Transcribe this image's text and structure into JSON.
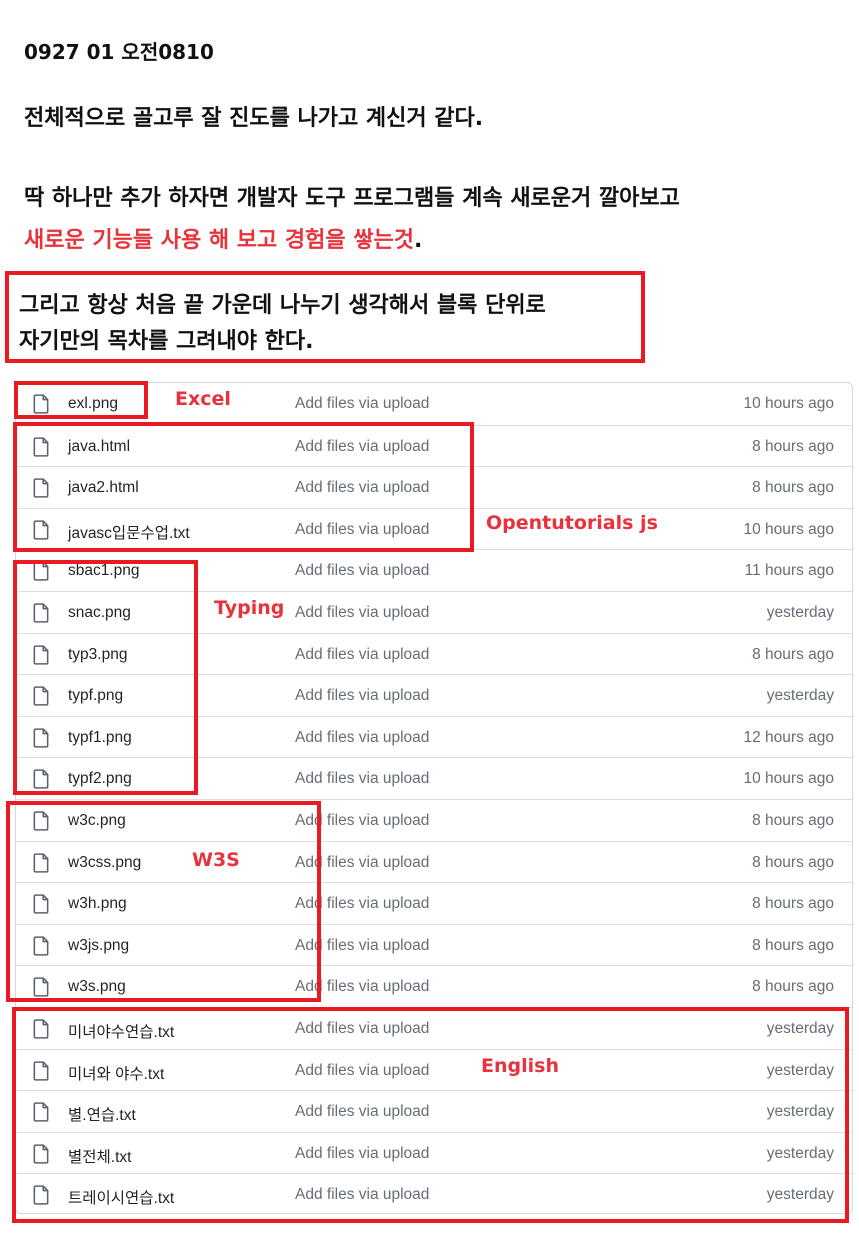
{
  "note": {
    "date": "0927 01 오전0810",
    "line1": "전체적으로 골고루 잘 진도를 나가고 계신거 같다.",
    "line2": "딱 하나만 추가 하자면 개발자 도구 프로그램들 계속 새로운거 깔아보고",
    "line3_red": "새로운 기능들 사용 해 보고 경험을 쌓는것",
    "line3_end": ".",
    "box_line1": "그리고 항상 처음 끝 가운데 나누기 생각해서 블록 단위로",
    "box_line2": "자기만의 목차를 그려내야 한다."
  },
  "files": [
    {
      "name": "exl.png",
      "message": "Add files via upload",
      "time": "10 hours ago",
      "icon": "file-icon"
    },
    {
      "name": "java.html",
      "message": "Add files via upload",
      "time": "8 hours ago",
      "icon": "file-icon"
    },
    {
      "name": "java2.html",
      "message": "Add files via upload",
      "time": "8 hours ago",
      "icon": "file-icon"
    },
    {
      "name": "javasc입문수업.txt",
      "message": "Add files via upload",
      "time": "10 hours ago",
      "icon": "file-icon"
    },
    {
      "name": "sbac1.png",
      "message": "Add files via upload",
      "time": "11 hours ago",
      "icon": "file-icon"
    },
    {
      "name": "snac.png",
      "message": "Add files via upload",
      "time": "yesterday",
      "icon": "file-icon"
    },
    {
      "name": "typ3.png",
      "message": "Add files via upload",
      "time": "8 hours ago",
      "icon": "file-icon"
    },
    {
      "name": "typf.png",
      "message": "Add files via upload",
      "time": "yesterday",
      "icon": "file-icon"
    },
    {
      "name": "typf1.png",
      "message": "Add files via upload",
      "time": "12 hours ago",
      "icon": "file-icon"
    },
    {
      "name": "typf2.png",
      "message": "Add files via upload",
      "time": "10 hours ago",
      "icon": "file-icon"
    },
    {
      "name": "w3c.png",
      "message": "Add files via upload",
      "time": "8 hours ago",
      "icon": "file-icon"
    },
    {
      "name": "w3css.png",
      "message": "Add files via upload",
      "time": "8 hours ago",
      "icon": "file-icon"
    },
    {
      "name": "w3h.png",
      "message": "Add files via upload",
      "time": "8 hours ago",
      "icon": "file-icon"
    },
    {
      "name": "w3js.png",
      "message": "Add files via upload",
      "time": "8 hours ago",
      "icon": "file-icon"
    },
    {
      "name": "w3s.png",
      "message": "Add files via upload",
      "time": "8 hours ago",
      "icon": "file-icon"
    },
    {
      "name": "미녀야수연습.txt",
      "message": "Add files via upload",
      "time": "yesterday",
      "icon": "file-icon"
    },
    {
      "name": "미녀와 야수.txt",
      "message": "Add files via upload",
      "time": "yesterday",
      "icon": "file-icon"
    },
    {
      "name": "별.연습.txt",
      "message": "Add files via upload",
      "time": "yesterday",
      "icon": "file-icon"
    },
    {
      "name": "별전체.txt",
      "message": "Add files via upload",
      "time": "yesterday",
      "icon": "file-icon"
    },
    {
      "name": "트레이시연습.txt",
      "message": "Add files via upload",
      "time": "yesterday",
      "icon": "file-icon"
    }
  ],
  "annotations": {
    "excel": "Excel",
    "opentutorials": "Opentutorials js",
    "typing": "Typing",
    "w3s": "W3S",
    "english": "English"
  },
  "colors": {
    "annotation_red": "#e81b23",
    "text_red": "#e8323c",
    "muted": "#656d76"
  }
}
